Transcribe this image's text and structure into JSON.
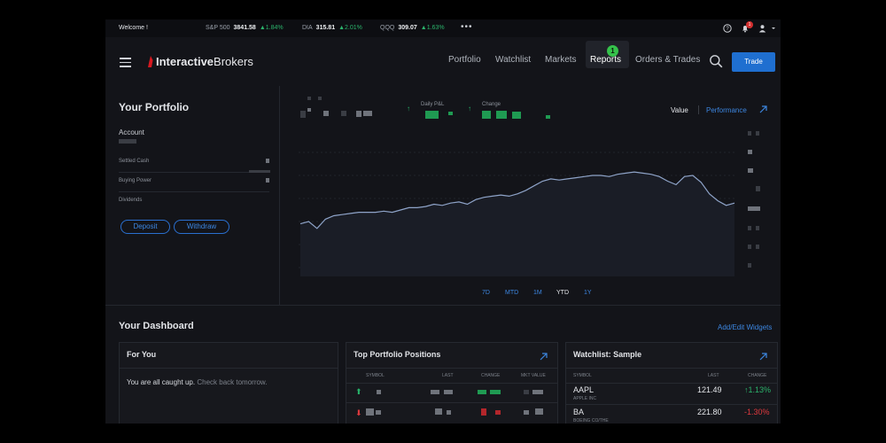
{
  "ticker": {
    "welcome": "Welcome !",
    "items": [
      {
        "name": "S&P 500",
        "price": "3841.58",
        "change": "▲1.84%"
      },
      {
        "name": "DIA",
        "price": "315.81",
        "change": "▲2.01%"
      },
      {
        "name": "QQQ",
        "price": "309.07",
        "change": "▲1.63%"
      }
    ],
    "more": "•••",
    "notification_count": "1",
    "colors": {
      "up": "#2bb36b",
      "badge": "#d32f2f"
    }
  },
  "nav": {
    "brand_bold": "Interactive",
    "brand_rest": "Brokers",
    "items": [
      "Portfolio",
      "Watchlist",
      "Markets",
      "Reports",
      "Orders & Trades"
    ],
    "highlight_badge": "1",
    "trade_label": "Trade",
    "colors": {
      "accent": "#1f6fd0",
      "highlight": "#35c24b"
    }
  },
  "portfolio": {
    "title": "Your Portfolio",
    "account_label": "Account",
    "rows": [
      "Settled Cash",
      "Buying Power",
      "Dividends"
    ],
    "deposit_label": "Deposit",
    "withdraw_label": "Withdraw",
    "daily_pnl_label": "Daily P&L",
    "change_label": "Change",
    "toggle_value": "Value",
    "toggle_performance": "Performance",
    "ranges": [
      "7D",
      "MTD",
      "1M",
      "YTD",
      "1Y"
    ],
    "selected_range": "YTD"
  },
  "dashboard": {
    "title": "Your Dashboard",
    "add_edit": "Add/Edit Widgets",
    "for_you": {
      "title": "For You",
      "message_main": "You are all caught up.",
      "message_sub": "Check back tomorrow."
    },
    "positions": {
      "title": "Top Portfolio Positions",
      "headers": [
        "SYMBOL",
        "LAST",
        "CHANGE",
        "MKT VALUE"
      ]
    },
    "watchlist": {
      "title": "Watchlist: Sample",
      "headers": [
        "SYMBOL",
        "LAST",
        "CHANGE"
      ],
      "rows": [
        {
          "symbol": "AAPL",
          "name": "APPLE INC",
          "last": "121.49",
          "change": "↑1.13%",
          "dir": "up"
        },
        {
          "symbol": "BA",
          "name": "BOEING CO/THE",
          "last": "221.80",
          "change": "-1.30%",
          "dir": "down"
        }
      ],
      "colors": {
        "up": "#2bb36b",
        "down": "#e0393e"
      }
    }
  },
  "chart_data": {
    "type": "line",
    "title": "",
    "xlabel": "",
    "ylabel": "",
    "grid": true,
    "series": [
      {
        "values": [
          38,
          40,
          34,
          42,
          45,
          46,
          47,
          48,
          48,
          48,
          49,
          48,
          50,
          52,
          52,
          53,
          55,
          54,
          56,
          57,
          55,
          59,
          61,
          62,
          63,
          62,
          64,
          67,
          71,
          75,
          77,
          76,
          77,
          78,
          79,
          80,
          80,
          79,
          81,
          82,
          83,
          82,
          81,
          79,
          75,
          72,
          79,
          80,
          74,
          64,
          58,
          54,
          56
        ]
      }
    ],
    "ylim": [
      0,
      100
    ]
  }
}
